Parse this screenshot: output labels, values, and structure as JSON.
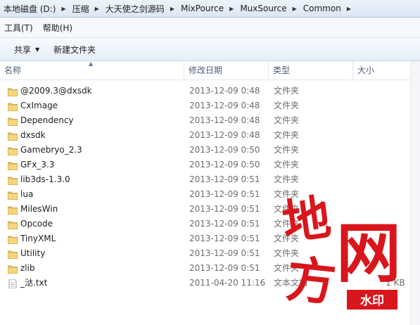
{
  "address": {
    "crumbs": [
      "本地磁盘 (D:)",
      "压缩",
      "大天使之剑源码",
      "MixPource",
      "MuxSource",
      "Common"
    ]
  },
  "menu": {
    "tools": "工具(T)",
    "help": "帮助(H)"
  },
  "toolbar": {
    "share": "共享",
    "new_folder": "新建文件夹"
  },
  "columns": {
    "name": "名称",
    "date": "修改日期",
    "type": "类型",
    "size": "大小"
  },
  "files": [
    {
      "name": "@2009.3@dxsdk",
      "date": "2013-12-09 0:48",
      "type": "文件夹",
      "size": "",
      "icon": "folder-icon"
    },
    {
      "name": "CxImage",
      "date": "2013-12-09 0:48",
      "type": "文件夹",
      "size": "",
      "icon": "folder-icon"
    },
    {
      "name": "Dependency",
      "date": "2013-12-09 0:48",
      "type": "文件夹",
      "size": "",
      "icon": "folder-icon"
    },
    {
      "name": "dxsdk",
      "date": "2013-12-09 0:48",
      "type": "文件夹",
      "size": "",
      "icon": "folder-icon"
    },
    {
      "name": "Gamebryo_2.3",
      "date": "2013-12-09 0:50",
      "type": "文件夹",
      "size": "",
      "icon": "folder-icon"
    },
    {
      "name": "GFx_3.3",
      "date": "2013-12-09 0:50",
      "type": "文件夹",
      "size": "",
      "icon": "folder-icon"
    },
    {
      "name": "lib3ds-1.3.0",
      "date": "2013-12-09 0:51",
      "type": "文件夹",
      "size": "",
      "icon": "folder-icon"
    },
    {
      "name": "lua",
      "date": "2013-12-09 0:51",
      "type": "文件夹",
      "size": "",
      "icon": "folder-icon"
    },
    {
      "name": "MilesWin",
      "date": "2013-12-09 0:51",
      "type": "文件夹",
      "size": "",
      "icon": "folder-icon"
    },
    {
      "name": "Opcode",
      "date": "2013-12-09 0:51",
      "type": "文件夹",
      "size": "",
      "icon": "folder-icon"
    },
    {
      "name": "TinyXML",
      "date": "2013-12-09 0:51",
      "type": "文件夹",
      "size": "",
      "icon": "folder-icon"
    },
    {
      "name": "Utility",
      "date": "2013-12-09 0:51",
      "type": "文件夹",
      "size": "",
      "icon": "folder-icon"
    },
    {
      "name": "zlib",
      "date": "2013-12-09 0:51",
      "type": "文件夹",
      "size": "",
      "icon": "folder-icon"
    },
    {
      "name": "_㳠.txt",
      "date": "2011-04-20 11:16",
      "type": "文本文档",
      "size": "1 KB",
      "icon": "text-file-icon"
    }
  ],
  "watermark": {
    "chars": [
      "地",
      "方",
      "网"
    ],
    "badge": "水印",
    "color": "#d8161c"
  }
}
